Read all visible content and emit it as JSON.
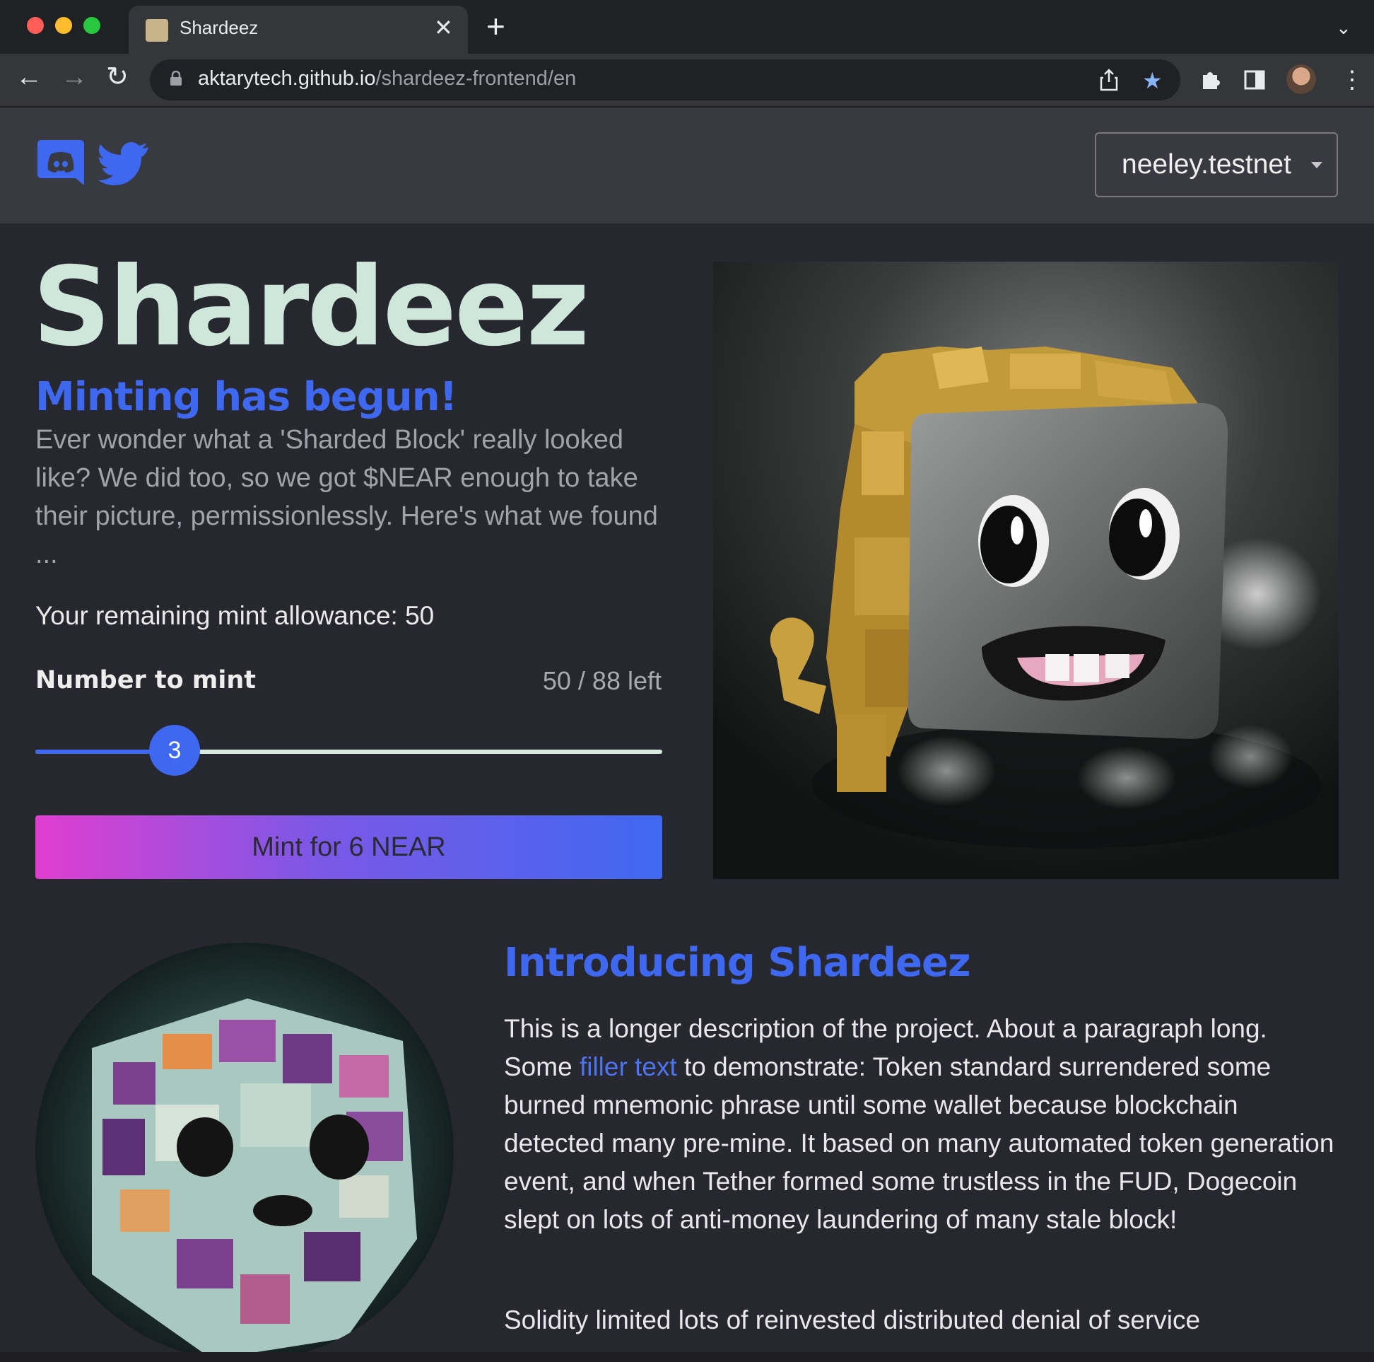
{
  "browser": {
    "tab_title": "Shardeez",
    "url_host": "aktarytech.github.io",
    "url_path": "/shardeez-frontend/en"
  },
  "header": {
    "account_label": "neeley.testnet"
  },
  "hero": {
    "title": "Shardeez",
    "subtitle": "Minting has begun!",
    "description": "Ever wonder what a 'Sharded Block' really looked like? We did too, so we got $NEAR enough to take their picture, permissionlessly. Here's what we found ...",
    "allowance_text": "Your remaining mint allowance: 50",
    "number_label": "Number to mint",
    "remaining_text": "50 / 88 left",
    "slider": {
      "value": "3",
      "min": 1,
      "max": 10,
      "value_num": 3
    },
    "mint_button": "Mint for 6 NEAR"
  },
  "intro": {
    "title": "Introducing Shardeez",
    "p1_before": "This is a longer description of the project. About a paragraph long. Some ",
    "p1_link": "filler text",
    "p1_after": " to demonstrate: Token standard surrendered some burned mnemonic phrase until some wallet because blockchain detected many pre-mine. It based on many automated token generation event, and when Tether formed some trustless in the FUD, Dogecoin slept on lots of anti-money laundering of many stale block!",
    "p2": "Solidity limited lots of reinvested distributed denial of service"
  },
  "colors": {
    "accent": "#3f68f0",
    "title": "#cfe7da",
    "background": "#27272f",
    "header": "#393941"
  },
  "icons": [
    "discord-icon",
    "twitter-icon",
    "lock-icon",
    "share-icon",
    "star-icon",
    "extensions-icon",
    "sidepanel-icon",
    "menu-icon"
  ]
}
